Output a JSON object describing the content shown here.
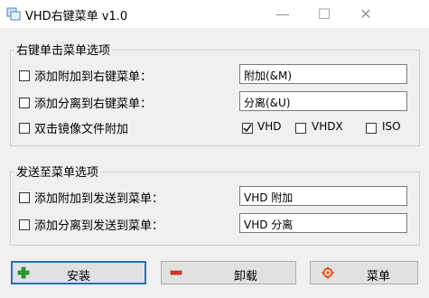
{
  "window": {
    "title": "VHD右键菜单 v1.0",
    "controls": {
      "minimize": "—",
      "maximize": "☐",
      "close": "✕"
    }
  },
  "group1": {
    "title": "右键单击菜单选项",
    "rows": [
      {
        "label": "添加附加到右键菜单：",
        "value": "附加(&M)",
        "checked": false
      },
      {
        "label": "添加分离到右键菜单：",
        "value": "分离(&U)",
        "checked": false
      }
    ],
    "mount": {
      "label": "双击镜像文件附加",
      "checked": false,
      "options": [
        {
          "label": "VHD",
          "checked": true
        },
        {
          "label": "VHDX",
          "checked": false
        },
        {
          "label": "ISO",
          "checked": false
        }
      ]
    }
  },
  "group2": {
    "title": "发送至菜单选项",
    "rows": [
      {
        "label": "添加附加到发送到菜单：",
        "value": "VHD 附加",
        "checked": false
      },
      {
        "label": "添加分离到发送到菜单：",
        "value": "VHD 分离",
        "checked": false
      }
    ]
  },
  "buttons": {
    "install": "安装",
    "uninstall": "卸载",
    "menu": "菜单"
  },
  "colors": {
    "install_icon": "#2e9b2e",
    "uninstall_icon": "#d9342b",
    "menu_icon": "#e05a1c",
    "focus_border": "#1f73c9"
  }
}
